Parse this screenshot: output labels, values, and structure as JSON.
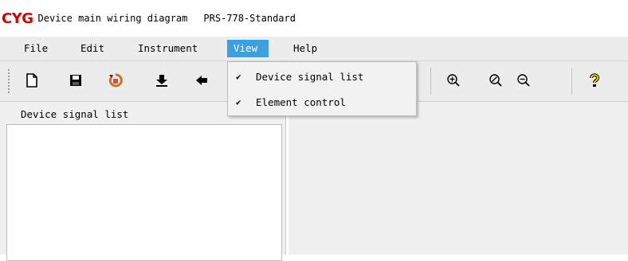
{
  "window": {
    "logo": "CYG",
    "title": "Device main wiring diagram",
    "model": "PRS-778-Standard"
  },
  "menubar": {
    "items": [
      {
        "label": "File"
      },
      {
        "label": "Edit"
      },
      {
        "label": "Instrument"
      },
      {
        "label": "View",
        "active": true
      },
      {
        "label": "Help"
      }
    ]
  },
  "toolbar": {
    "buttons": [
      {
        "icon": "new-file-icon"
      },
      {
        "icon": "save-icon"
      },
      {
        "icon": "refresh-icon"
      },
      {
        "icon": "download-icon"
      },
      {
        "icon": "back-icon"
      },
      {
        "icon": "zoom-in-icon"
      },
      {
        "icon": "zoom-fit-icon"
      },
      {
        "icon": "zoom-out-icon"
      },
      {
        "icon": "help-icon"
      }
    ]
  },
  "view_menu": {
    "items": [
      {
        "label": "Device signal list",
        "checked": true,
        "check": "✔"
      },
      {
        "label": "Element control",
        "checked": true,
        "check": "✔"
      }
    ]
  },
  "left_panel": {
    "title": "Device signal list"
  },
  "colors": {
    "logo": "#d40000",
    "menu_active": "#3d9fe0",
    "chrome_bg": "#ececec"
  }
}
